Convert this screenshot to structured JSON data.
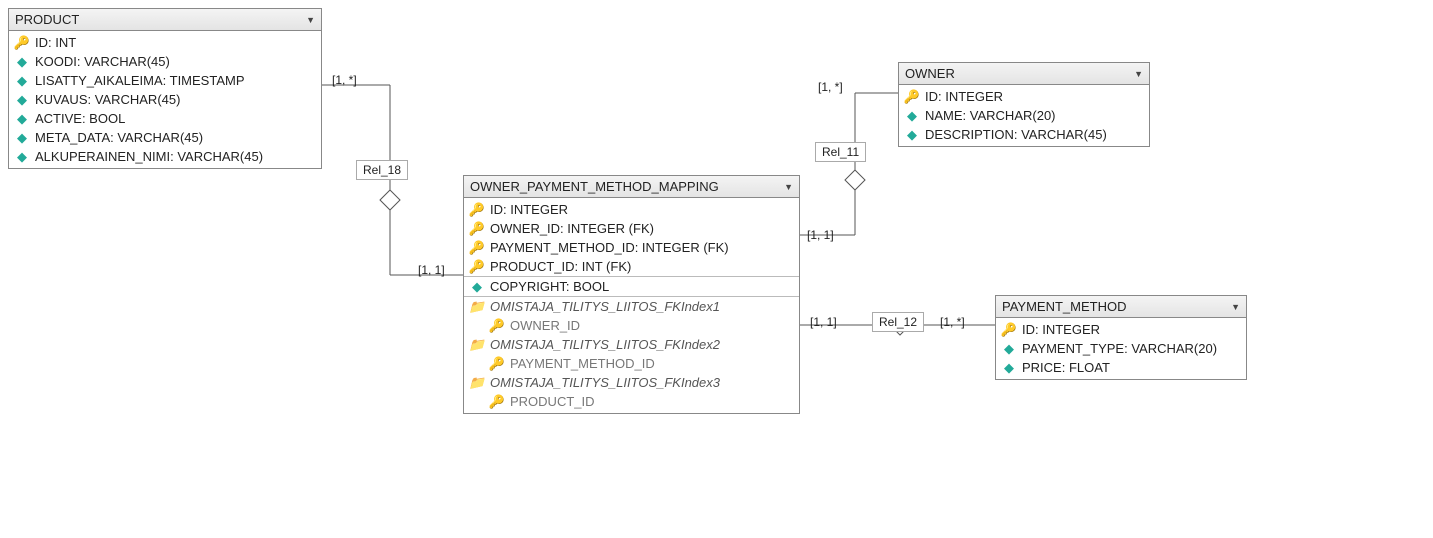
{
  "tables": {
    "product": {
      "title": "PRODUCT",
      "cols": [
        {
          "icon": "key",
          "text": "ID: INT"
        },
        {
          "icon": "dia",
          "text": "KOODI: VARCHAR(45)"
        },
        {
          "icon": "dia",
          "text": "LISATTY_AIKALEIMA: TIMESTAMP"
        },
        {
          "icon": "dia",
          "text": "KUVAUS: VARCHAR(45)"
        },
        {
          "icon": "dia",
          "text": "ACTIVE: BOOL"
        },
        {
          "icon": "dia",
          "text": "META_DATA: VARCHAR(45)"
        },
        {
          "icon": "dia",
          "text": "ALKUPERAINEN_NIMI: VARCHAR(45)"
        }
      ]
    },
    "owner": {
      "title": "OWNER",
      "cols": [
        {
          "icon": "key",
          "text": "ID: INTEGER"
        },
        {
          "icon": "dia",
          "text": "NAME: VARCHAR(20)"
        },
        {
          "icon": "dia",
          "text": "DESCRIPTION: VARCHAR(45)"
        }
      ]
    },
    "mapping": {
      "title": "OWNER_PAYMENT_METHOD_MAPPING",
      "keys": [
        {
          "icon": "key",
          "text": "ID: INTEGER"
        },
        {
          "icon": "key",
          "text": "OWNER_ID: INTEGER (FK)"
        },
        {
          "icon": "key",
          "text": "PAYMENT_METHOD_ID: INTEGER (FK)"
        },
        {
          "icon": "key",
          "text": "PRODUCT_ID: INT (FK)"
        }
      ],
      "attrs": [
        {
          "icon": "dia",
          "text": "COPYRIGHT: BOOL"
        }
      ],
      "indexes": [
        {
          "name": "OMISTAJA_TILITYS_LIITOS_FKIndex1",
          "col": "OWNER_ID"
        },
        {
          "name": "OMISTAJA_TILITYS_LIITOS_FKIndex2",
          "col": "PAYMENT_METHOD_ID"
        },
        {
          "name": "OMISTAJA_TILITYS_LIITOS_FKIndex3",
          "col": "PRODUCT_ID"
        }
      ]
    },
    "payment": {
      "title": "PAYMENT_METHOD",
      "cols": [
        {
          "icon": "key",
          "text": "ID: INTEGER"
        },
        {
          "icon": "dia",
          "text": "PAYMENT_TYPE: VARCHAR(20)"
        },
        {
          "icon": "dia",
          "text": "PRICE: FLOAT"
        }
      ]
    }
  },
  "relations": {
    "rel18": {
      "label": "Rel_18",
      "card1": "[1, *]",
      "card2": "[1, 1]"
    },
    "rel11": {
      "label": "Rel_11",
      "card1": "[1, *]",
      "card2": "[1, 1]"
    },
    "rel12": {
      "label": "Rel_12",
      "card1": "[1, 1]",
      "card2": "[1, *]"
    }
  }
}
